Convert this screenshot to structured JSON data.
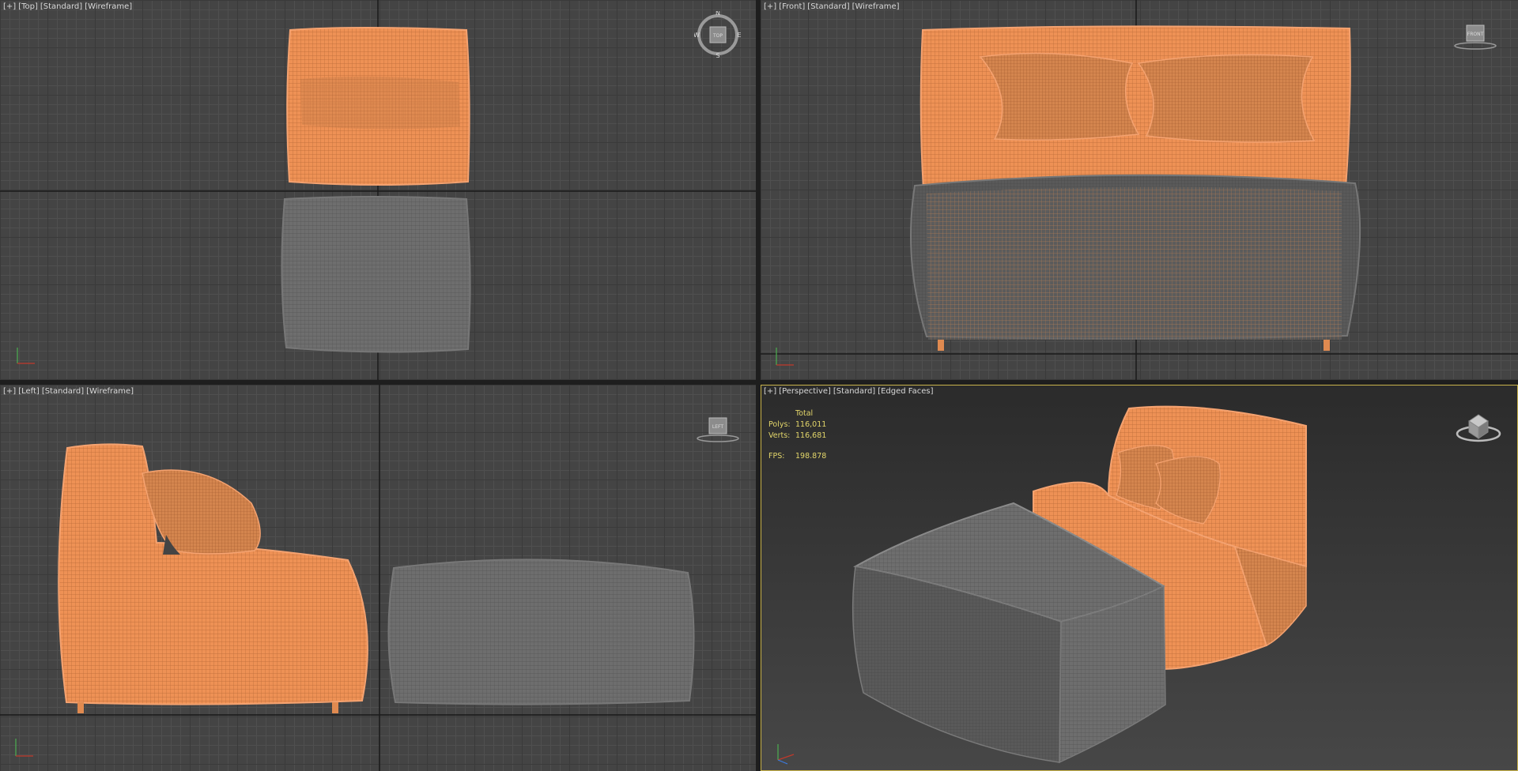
{
  "viewports": {
    "top": {
      "labels": [
        "[+]",
        "[Top]",
        "[Standard]",
        "[Wireframe]"
      ],
      "compass": {
        "n": "N",
        "s": "S",
        "e": "E",
        "w": "W",
        "cube": "TOP"
      }
    },
    "front": {
      "labels": [
        "[+]",
        "[Front]",
        "[Standard]",
        "[Wireframe]"
      ],
      "cube": "FRONT"
    },
    "left": {
      "labels": [
        "[+]",
        "[Left]",
        "[Standard]",
        "[Wireframe]"
      ],
      "cube": "LEFT"
    },
    "perspective": {
      "labels": [
        "[+]",
        "[Perspective]",
        "[Standard]",
        "[Edged Faces]"
      ]
    }
  },
  "stats": {
    "total_label": "Total",
    "polys_label": "Polys:",
    "polys": "116,011",
    "verts_label": "Verts:",
    "verts": "116,681",
    "fps_label": "FPS:",
    "fps": "198.878"
  },
  "colors": {
    "selected": "#f0975a",
    "unselected": "#6c6c6c",
    "active_border": "#c8b24a",
    "stats_text": "#e3d66a"
  },
  "icons": [
    "viewcube-compass-icon",
    "viewcube-icon",
    "axis-tripod-icon"
  ]
}
